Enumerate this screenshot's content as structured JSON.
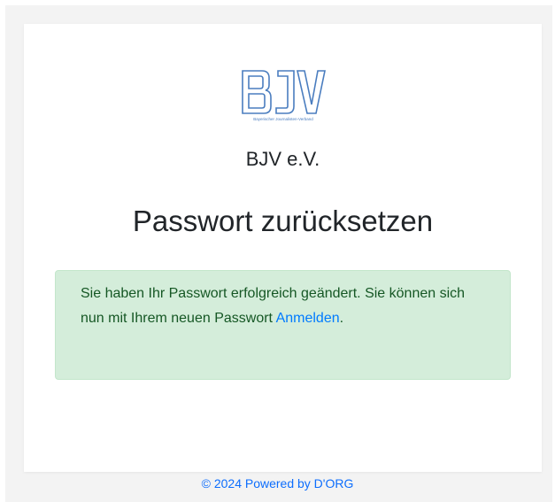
{
  "logo": {
    "letters": "BJV",
    "tagline": "Bayerischer Journalisten-Verband",
    "color": "#4a7dbf"
  },
  "org_name": "BJV e.V.",
  "page_title": "Passwort zurücksetzen",
  "alert": {
    "message": "Sie haben Ihr Passwort erfolgreich geändert. Sie können sich nun mit Ihrem neuen Passwort ",
    "link_label": "Anmelden",
    "suffix": "."
  },
  "footer": {
    "text": "© 2024 Powered by D'ORG"
  },
  "colors": {
    "alert_bg": "#d4edda",
    "alert_text": "#155724",
    "link": "#007bff"
  }
}
